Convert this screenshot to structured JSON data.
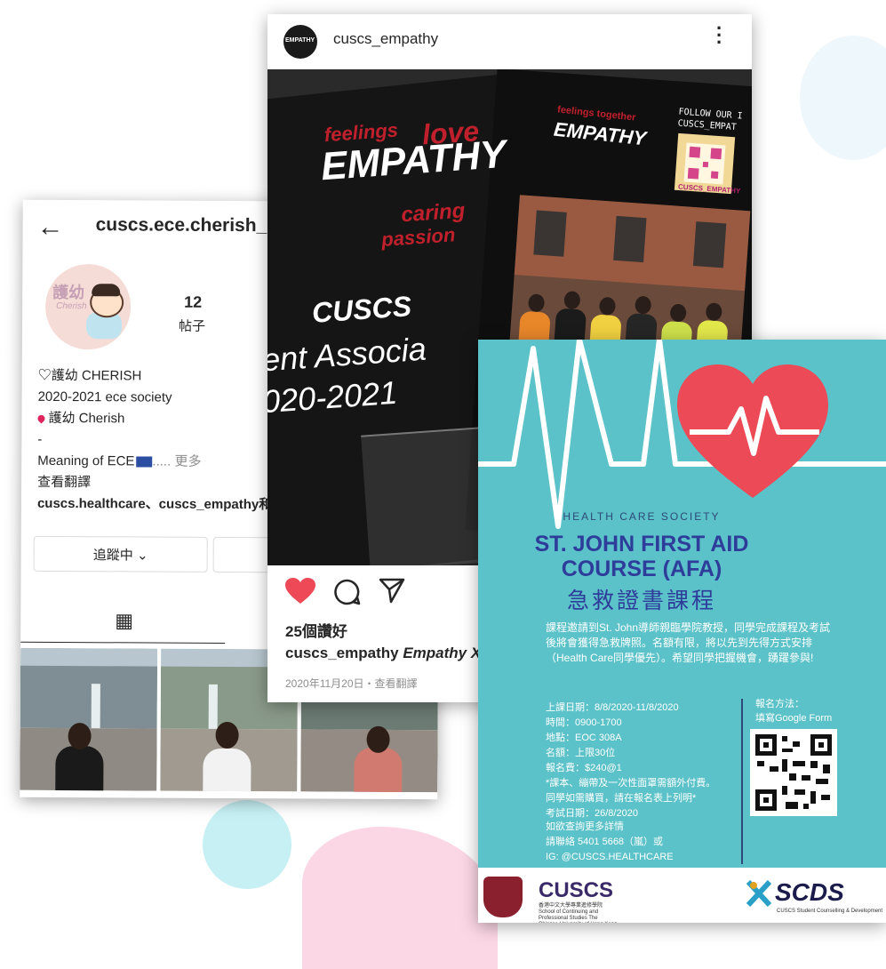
{
  "profile": {
    "username": "cuscs.ece.cherish_",
    "avatar_text": "護幼",
    "avatar_sub": "Cherish",
    "posts_count": "12",
    "posts_label": "帖子",
    "bio_lines": {
      "name": "♡護幼 CHERISH",
      "line2": "2020-2021 ece society",
      "line3": "護幼 Cherish",
      "line4": "-",
      "line5": "Meaning of ECE",
      "line5_more": "..... 更多",
      "translate": "查看翻譯",
      "followed_by": "cuscs.healthcare、cuscs_empathy和"
    },
    "follow_button": "追蹤中 ⌄",
    "grid_icon": "grid-icon"
  },
  "post": {
    "username": "cuscs_empathy",
    "avatar_text": "EMPATHY",
    "image": {
      "empathy": "EMPATHY",
      "words_top": "feelings",
      "words_love": "love",
      "words_caring": "caring",
      "words_passion": "passion",
      "cuscs": "CUSCS",
      "assoc": "ent Associa",
      "year": "020-2021",
      "follow": "FOLLOW OUR I",
      "follow2": "CUSCS_EMPAT",
      "qr_label": "CUSCS_EMPATHY",
      "small_empathy": "EMPATHY",
      "small_heart": "feelings together"
    },
    "likes": "25個讚好",
    "caption_user": "cuscs_empathy",
    "caption_text": "Empathy X",
    "date": "2020年11月20日",
    "translate": "・查看翻譯"
  },
  "poster": {
    "society": "HEALTH CARE SOCIETY",
    "title_line1": "ST. JOHN FIRST AID",
    "title_line2": "COURSE (AFA)",
    "title_chinese": "急救證書課程",
    "intro": "課程邀請到St. John導師親臨學院教授，同學完成課程及考試後將會獲得急救牌照。名額有限，將以先到先得方式安排（Health Care同學優先）。希望同學把握機會，踴躍參與!",
    "details": [
      "上課日期：8/8/2020-11/8/2020",
      "時間：0900-1700",
      "地點：EOC 308A",
      "名額：上限30位",
      "報名費：$240@1",
      "*課本、繃帶及一次性面罩需額外付費。",
      "同學如需購買，請在報名表上列明*",
      "考試日期：26/8/2020"
    ],
    "contact": [
      "如欲查詢更多詳情",
      "請聯絡 5401 5668（嵐）或",
      "IG: @CUSCS.HEALTHCARE"
    ],
    "register_label": "報名方法：",
    "register_method": "填寫Google  Form",
    "footer_cuscs": "CUSCS",
    "footer_cuscs_sub": "香港中文大學專業進修學院 School of Continuing and Professional Studies The Chinese University of Hong Kong",
    "footer_scds": "SCDS",
    "footer_scds_sub": "CUSCS Student Counselling & Development"
  },
  "colors": {
    "poster_bg": "#5bc2c9",
    "poster_title": "#2e3c9a",
    "heart_red": "#ec4a56",
    "like_red": "#ed4956"
  }
}
